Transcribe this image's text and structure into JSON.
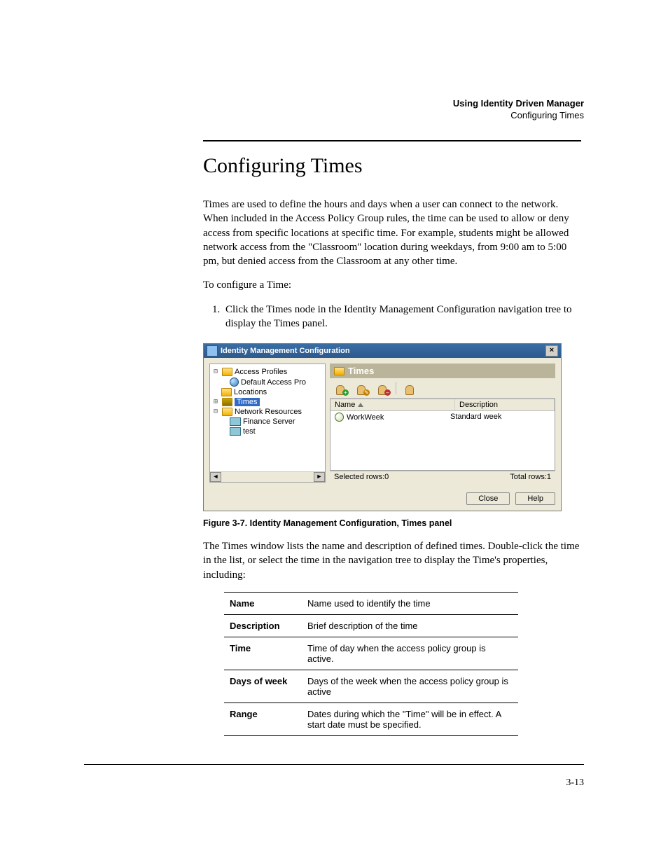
{
  "running_head": {
    "title": "Using Identity Driven Manager",
    "subtitle": "Configuring Times"
  },
  "heading": "Configuring Times",
  "para1": "Times are used to define the hours and days when a user can connect to the network. When included in the Access Policy Group rules, the time can be used to allow or deny access from specific locations at specific time. For example, students might be allowed network access from the \"Classroom\" location during weekdays, from 9:00 am to 5:00 pm, but denied access from the Classroom at any other time.",
  "para2": "To configure a Time:",
  "step1": "Click the Times node in the Identity Management Configuration navigation tree to display the Times panel.",
  "figure_caption": "Figure 3-7. Identity Management Configuration, Times panel",
  "para3": "The Times window lists the name and description of defined times. Double-click the time in the list, or select the time in the navigation tree to display the Time's properties, including:",
  "props": {
    "name_k": "Name",
    "name_v": "Name used to identify the time",
    "desc_k": "Description",
    "desc_v": "Brief description of the time",
    "time_k": "Time",
    "time_v": "Time of day when the access policy group is active.",
    "dow_k": "Days of week",
    "dow_v": "Days of the week when the access policy group is active",
    "range_k": "Range",
    "range_v": "Dates during which the \"Time\" will be in effect. A start date must be specified."
  },
  "app": {
    "title": "Identity Management Configuration",
    "close_x": "×",
    "tree": {
      "access_profiles": "Access Profiles",
      "default_access": "Default Access Pro",
      "locations": "Locations",
      "times": "Times",
      "network_resources": "Network Resources",
      "finance_server": "Finance Server",
      "test": "test"
    },
    "panel_title": "Times",
    "columns": {
      "name": "Name",
      "desc": "Description"
    },
    "rows": [
      {
        "name": "WorkWeek",
        "desc": "Standard week"
      }
    ],
    "status": {
      "selected": "Selected rows:0",
      "total": "Total rows:1"
    },
    "buttons": {
      "close": "Close",
      "help": "Help"
    }
  },
  "pagenum": "3-13"
}
